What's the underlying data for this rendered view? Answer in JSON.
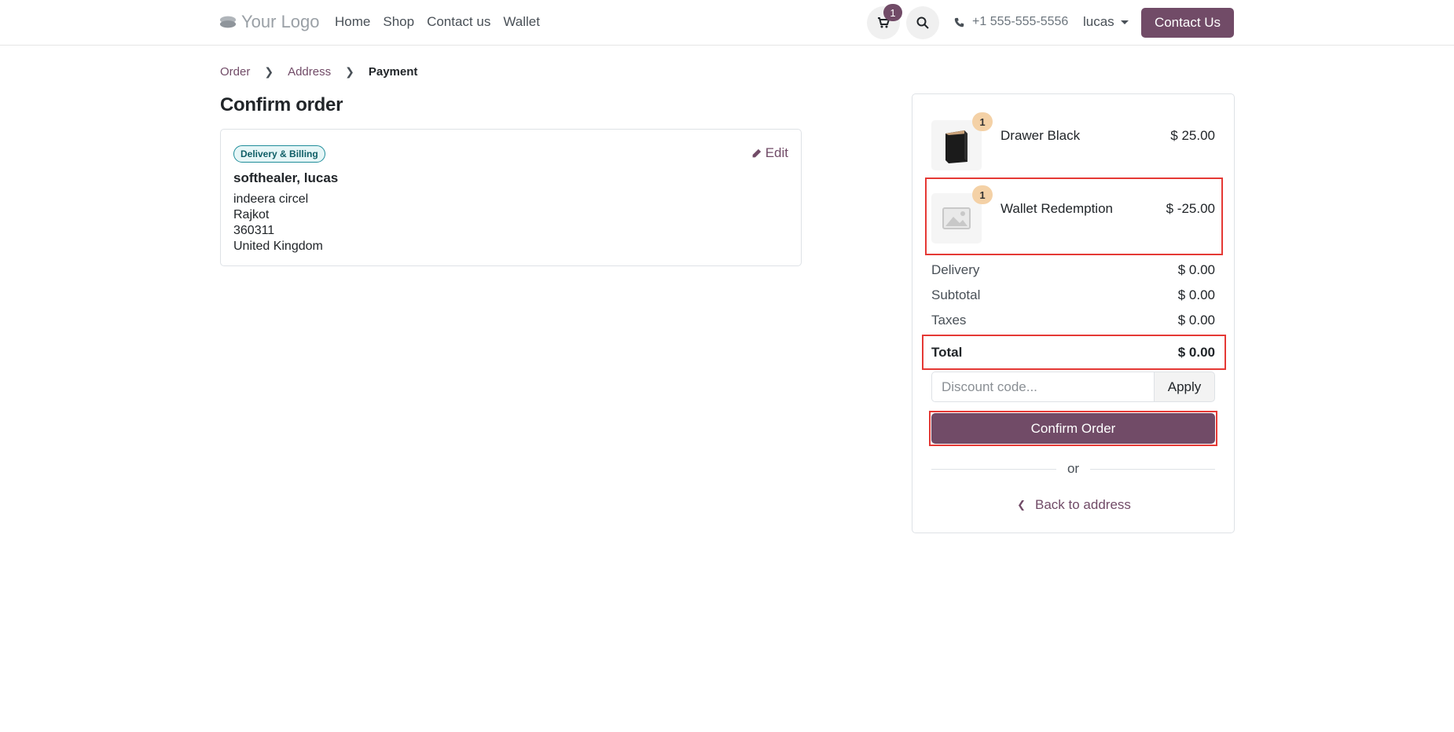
{
  "header": {
    "logo_text": "Your Logo",
    "nav": [
      "Home",
      "Shop",
      "Contact us",
      "Wallet"
    ],
    "cart_count": "1",
    "phone": "+1 555-555-5556",
    "user": "lucas",
    "contact_button": "Contact Us",
    "brand_color": "#714b67"
  },
  "breadcrumb": {
    "items": [
      "Order",
      "Address",
      "Payment"
    ]
  },
  "page_title": "Confirm order",
  "address": {
    "badge": "Delivery & Billing",
    "edit_label": "Edit",
    "name": "softhealer, lucas",
    "lines": [
      "indeera circel",
      "Rajkot",
      "360311",
      "United Kingdom"
    ]
  },
  "summary": {
    "items": [
      {
        "qty": "1",
        "name": "Drawer Black",
        "price": "$ 25.00"
      },
      {
        "qty": "1",
        "name": "Wallet Redemption",
        "price": "$ -25.00"
      }
    ],
    "rows": [
      {
        "label": "Delivery",
        "value": "$ 0.00"
      },
      {
        "label": "Subtotal",
        "value": "$ 0.00"
      },
      {
        "label": "Taxes",
        "value": "$ 0.00"
      }
    ],
    "total": {
      "label": "Total",
      "value": "$ 0.00"
    },
    "discount_placeholder": "Discount code...",
    "apply_label": "Apply",
    "confirm_label": "Confirm Order",
    "or_label": "or",
    "back_label": "Back to address"
  }
}
